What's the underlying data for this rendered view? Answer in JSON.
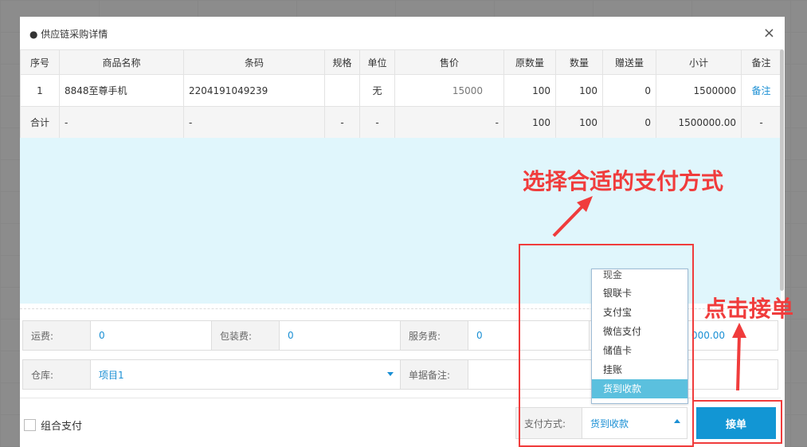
{
  "modal": {
    "title": "● 供应链采购详情",
    "close_icon": "×"
  },
  "table": {
    "headers": [
      "序号",
      "商品名称",
      "条码",
      "规格",
      "单位",
      "售价",
      "原数量",
      "数量",
      "赠送量",
      "小计",
      "备注"
    ],
    "rows": [
      [
        "1",
        "8848至尊手机",
        "2204191049239",
        "",
        "无",
        "15000",
        "100",
        "100",
        "0",
        "1500000",
        "备注"
      ]
    ],
    "total": [
      "合计",
      "-",
      "-",
      "-",
      "-",
      "-",
      "100",
      "100",
      "0",
      "1500000.00",
      "-"
    ]
  },
  "fees": {
    "freight_label": "运费:",
    "freight_value": "0",
    "packing_label": "包装费:",
    "packing_value": "0",
    "service_label": "服务费:",
    "service_value": "0",
    "total_partial": "000.00"
  },
  "warehouse": {
    "label": "仓库:",
    "value": "项目1"
  },
  "remark": {
    "label": "单据备注:"
  },
  "combo_pay": {
    "label": "组合支付"
  },
  "payment": {
    "label": "支付方式:",
    "value": "货到收款",
    "options": [
      "现金",
      "银联卡",
      "支付宝",
      "微信支付",
      "储值卡",
      "挂账",
      "货到收款"
    ],
    "selected": "货到收款"
  },
  "confirm_button": "接单",
  "annotations": {
    "choose_payment": "选择合适的支付方式",
    "click_confirm": "点击接单",
    "color": "#f03c3c"
  },
  "colors": {
    "accent": "#1296d4",
    "link": "#1a8fd4",
    "highlight": "#5bc0de",
    "empty_area": "#e0f6fc"
  }
}
